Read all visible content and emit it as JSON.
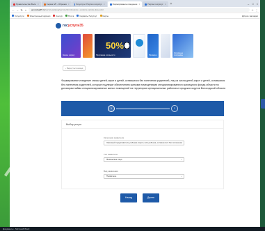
{
  "tabs": [
    {
      "label": "Правительство Воло",
      "active": false,
      "color": "#d33"
    },
    {
      "label": "Сервис 25 - Образов",
      "active": false,
      "color": "#e07020"
    },
    {
      "label": "Госуслуги: Портал госуслуг",
      "active": false,
      "color": "#2b6fd6"
    },
    {
      "label": "Формирование и ведение",
      "active": true,
      "color": "#2b6fd6"
    },
    {
      "label": "Портал госуслуг",
      "active": false,
      "color": "#2b6fd6"
    }
  ],
  "address": {
    "host": "gosuslugi35.ru",
    "path": "/servicecatalog/service/formirovanie-i-vedenie-spiska-detej-sirot"
  },
  "bookmarks": [
    {
      "label": "Госуслуги",
      "color": "#2b6fd6"
    },
    {
      "label": "Электронный журнал",
      "color": "#e07020"
    },
    {
      "label": "Контур",
      "color": "#d33"
    },
    {
      "label": "Почта",
      "color": "#3a9a3a"
    },
    {
      "label": "Сервисы Госуслуг",
      "color": "#2b6fd6"
    },
    {
      "label": "Карты",
      "color": "#e0a020"
    }
  ],
  "bookmarks_right": "Другие закладки",
  "site": {
    "logo_main": "гос",
    "logo_accent": "услуги",
    "logo_region": "35"
  },
  "banners": [
    {
      "caption": "Запись к врачу"
    },
    {
      "caption": ""
    },
    {
      "caption": "Программа лояльности",
      "percent": "50%"
    },
    {
      "caption": ""
    },
    {
      "caption": "Проверка"
    },
    {
      "caption": ""
    },
    {
      "caption": "Жилищные программы"
    }
  ],
  "back_label": "Вернуться назад",
  "service_title": "Формирование и ведение списка детей-сирот и детей, оставшихся без попечения родителей, лиц из числа детей-сирот и детей, оставшихся без попечения родителей, которые подлежат обеспечению жилыми помещениями специализированного жилищного фонда области по договорам найма специализированных жилых помещений на территории муниципальных районов и городских округов Вологодской области",
  "steps": [
    "1",
    "2"
  ],
  "form": {
    "section_title": "Выбор услуги",
    "fields": [
      {
        "label": "Категория заявителя",
        "value": "Законный представитель ребенка-сироты или ребенка, оставшегося без попечения"
      },
      {
        "label": "Тип заявителя",
        "value": "Физическое лицо"
      },
      {
        "label": "Вид заявления",
        "value": "Первичное"
      }
    ]
  },
  "buttons": {
    "back": "Назад",
    "next": "Далее"
  },
  "taskbar_text": "Документы - Microsoft Word"
}
